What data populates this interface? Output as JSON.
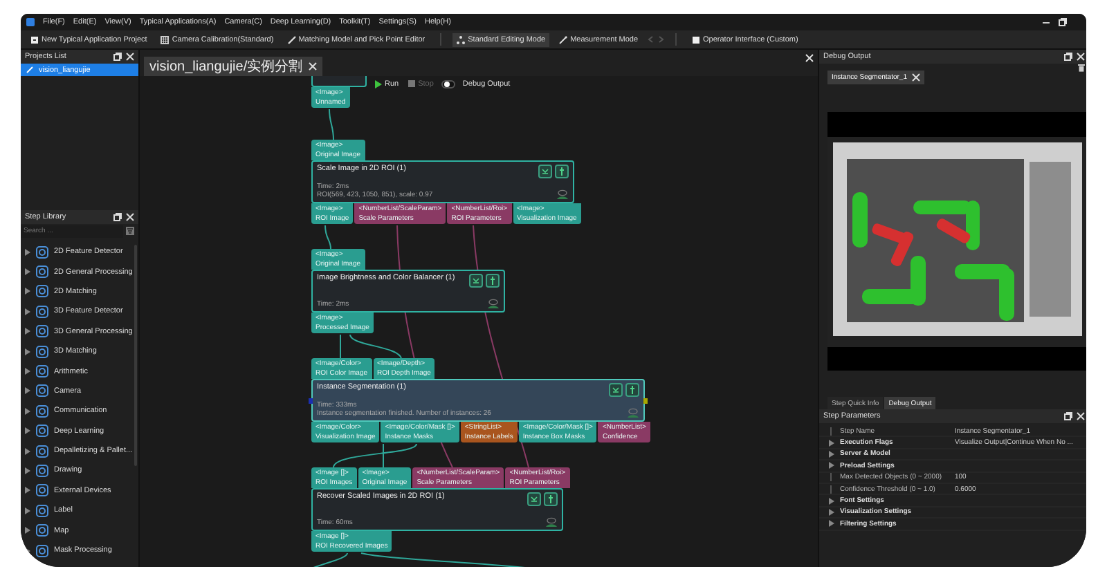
{
  "menu": [
    "File(F)",
    "Edit(E)",
    "View(V)",
    "Typical Applications(A)",
    "Camera(C)",
    "Deep Learning(D)",
    "Toolkit(T)",
    "Settings(S)",
    "Help(H)"
  ],
  "toolbar": [
    [
      {
        "label": "New Typical Application Project",
        "selected": false
      },
      {
        "label": "Camera Calibration(Standard)",
        "selected": false
      },
      {
        "label": "Matching Model and Pick Point Editor",
        "selected": false
      }
    ],
    [
      {
        "label": "Standard Editing Mode",
        "selected": true
      },
      {
        "label": "Measurement Mode",
        "selected": false
      }
    ],
    [
      {
        "label": "Operator Interface (Custom)",
        "selected": false
      }
    ]
  ],
  "projects": {
    "title": "Projects List",
    "items": [
      {
        "label": "vision_liangujie",
        "selected": true
      }
    ]
  },
  "step_library": {
    "title": "Step Library",
    "search": {
      "placeholder": "Search ..."
    },
    "items": [
      {
        "label": "2D Feature Detector",
        "expanded": false
      },
      {
        "label": "2D General Processing",
        "expanded": false
      },
      {
        "label": "2D Matching",
        "expanded": false
      },
      {
        "label": "3D Feature Detector",
        "expanded": false
      },
      {
        "label": "3D General Processing",
        "expanded": false
      },
      {
        "label": "3D Matching",
        "expanded": false
      },
      {
        "label": "Arithmetic",
        "expanded": false
      },
      {
        "label": "Camera",
        "expanded": false
      },
      {
        "label": "Communication",
        "expanded": false
      },
      {
        "label": "Deep Learning",
        "expanded": false
      },
      {
        "label": "Depalletizing & Pallet...",
        "expanded": false
      },
      {
        "label": "Drawing",
        "expanded": false
      },
      {
        "label": "External Devices",
        "expanded": false
      },
      {
        "label": "Label",
        "expanded": false
      },
      {
        "label": "Map",
        "expanded": false
      },
      {
        "label": "Mask Processing",
        "expanded": false
      }
    ]
  },
  "editor": {
    "tabs": [
      {
        "label": "vision_liangujie/实例分割",
        "selected": true
      }
    ],
    "run_bar": {
      "run": {
        "label": "Run",
        "disabled": false
      },
      "stop": {
        "label": "Stop",
        "disabled": true
      },
      "debug_output": {
        "label": "Debug Output",
        "on": false
      }
    },
    "nodes": [
      {
        "kind": "cut_off",
        "outputs": [
          {
            "type": "<Image>",
            "name": "Unnamed"
          }
        ]
      },
      {
        "kind": "step",
        "title": "Scale Image in 2D ROI (1)",
        "selected": false,
        "lines": [
          "Time: 2ms",
          "ROI(569, 423, 1050, 851), scale: 0.97"
        ],
        "inputs": [
          {
            "type": "<Image>",
            "name": "Original Image"
          }
        ],
        "outputs": [
          {
            "type": "<Image>",
            "name": "ROI Image"
          },
          {
            "type": "<NumberList/ScaleParam>",
            "name": "Scale Parameters",
            "kind": "number"
          },
          {
            "type": "<NumberList/Roi>",
            "name": "ROI Parameters",
            "kind": "number"
          },
          {
            "type": "<Image>",
            "name": "Visualization Image"
          }
        ]
      },
      {
        "kind": "step",
        "title": "Image Brightness and Color Balancer (1)",
        "selected": false,
        "lines": [
          "Time: 2ms"
        ],
        "inputs": [
          {
            "type": "<Image>",
            "name": "Original Image"
          }
        ],
        "outputs": [
          {
            "type": "<Image>",
            "name": "Processed Image"
          }
        ]
      },
      {
        "kind": "step",
        "title": "Instance Segmentation (1)",
        "selected": true,
        "lines": [
          "Time: 333ms",
          "Instance segmentation finished. Number of instances: 26"
        ],
        "inputs": [
          {
            "type": "<Image/Color>",
            "name": "ROI Color Image"
          },
          {
            "type": "<Image/Depth>",
            "name": "ROI Depth Image"
          }
        ],
        "outputs": [
          {
            "type": "<Image/Color>",
            "name": "Visualization Image"
          },
          {
            "type": "<Image/Color/Mask []>",
            "name": "Instance Masks"
          },
          {
            "type": "<StringList>",
            "name": "Instance Labels",
            "kind": "string"
          },
          {
            "type": "<Image/Color/Mask []>",
            "name": "Instance Box Masks"
          },
          {
            "type": "<NumberList>",
            "name": "Confidence",
            "kind": "number"
          }
        ]
      },
      {
        "kind": "step",
        "title": "Recover Scaled Images in 2D ROI (1)",
        "selected": false,
        "lines": [
          "Time: 60ms"
        ],
        "inputs": [
          {
            "type": "<Image []>",
            "name": "ROI Images"
          },
          {
            "type": "<Image>",
            "name": "Original Image"
          },
          {
            "type": "<NumberList/ScaleParam>",
            "name": "Scale Parameters",
            "kind": "number"
          },
          {
            "type": "<NumberList/Roi>",
            "name": "ROI Parameters",
            "kind": "number"
          }
        ],
        "outputs": [
          {
            "type": "<Image []>",
            "name": "ROI Recovered Images"
          }
        ]
      }
    ]
  },
  "debug_output": {
    "title": "Debug Output",
    "tabs": [
      {
        "label": "Instance Segmentator_1",
        "selected": true
      }
    ]
  },
  "bottom_tabs": [
    {
      "label": "Step Quick Info",
      "selected": false
    },
    {
      "label": "Debug Output",
      "selected": true
    }
  ],
  "step_parameters": {
    "title": "Step Parameters",
    "rows": [
      {
        "kind": "field",
        "name": "Step Name",
        "value": "Instance Segmentator_1"
      },
      {
        "kind": "group",
        "name": "Execution Flags",
        "value": "Visualize Output|Continue When No ...",
        "expanded": false
      },
      {
        "kind": "group",
        "name": "Server & Model",
        "expanded": false
      },
      {
        "kind": "group",
        "name": "Preload Settings",
        "expanded": false
      },
      {
        "kind": "field",
        "name": "Max Detected Objects (0 ~ 2000)",
        "value": "100"
      },
      {
        "kind": "field",
        "name": "Confidence Threshold (0 ~ 1.0)",
        "value": "0.6000"
      },
      {
        "kind": "group",
        "name": "Font Settings",
        "expanded": false
      },
      {
        "kind": "group",
        "name": "Visualization Settings",
        "expanded": false
      },
      {
        "kind": "group",
        "name": "Filtering Settings",
        "expanded": false
      }
    ]
  }
}
